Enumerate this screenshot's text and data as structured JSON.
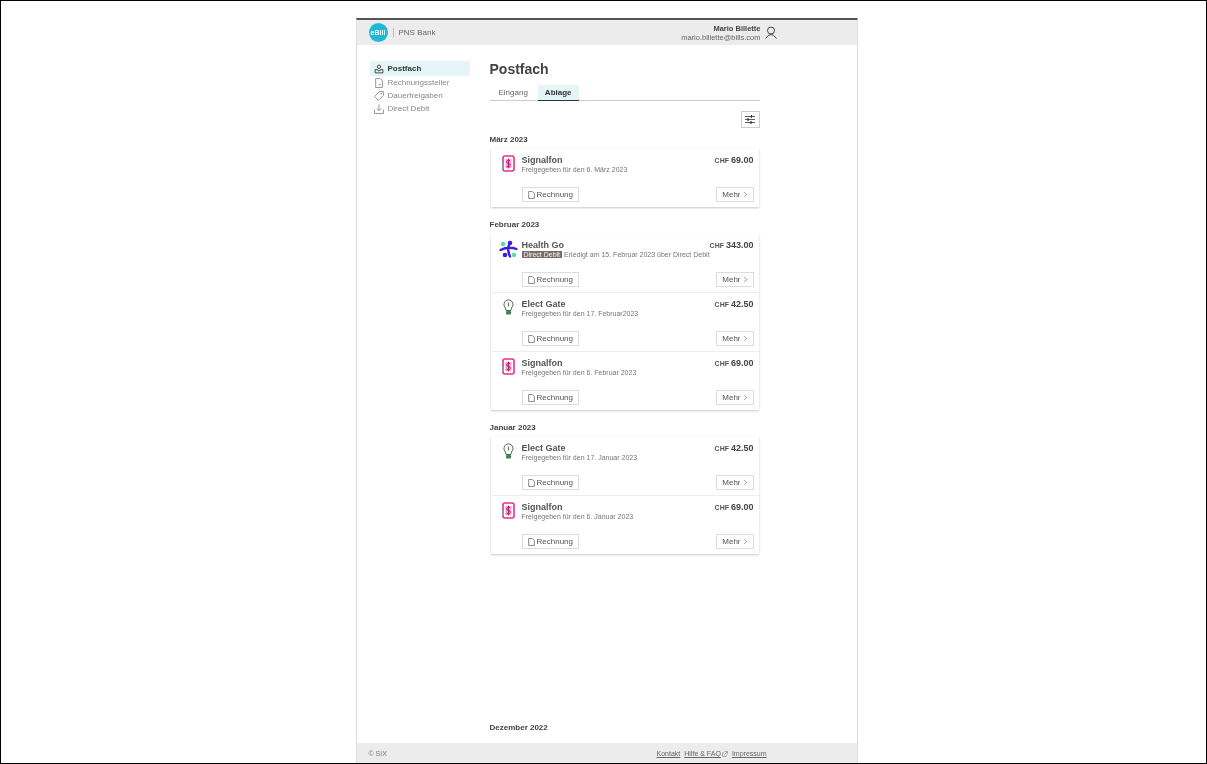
{
  "header": {
    "logo": "eBill",
    "bank": "PNS Bank",
    "user_name": "Mario Billette",
    "user_email": "mario.billette@bills.com"
  },
  "sidebar": {
    "items": [
      {
        "label": "Postfach",
        "selected": true
      },
      {
        "label": "Rechnungssteller",
        "selected": false
      },
      {
        "label": "Dauerfreigaben",
        "selected": false
      },
      {
        "label": "Direct Debit",
        "selected": false
      }
    ]
  },
  "page_title": "Postfach",
  "tabs": [
    {
      "label": "Eingang",
      "selected": false
    },
    {
      "label": "Ablage",
      "selected": true
    }
  ],
  "groups": [
    {
      "title": "März 2023",
      "bills": [
        {
          "biller": "Signalfon",
          "kind": "phone",
          "currency": "CHF",
          "amount": "69.00",
          "status": "Freigegeben für den 6. März 2023",
          "invoice_button": "Rechnung",
          "more_button": "Mehr"
        }
      ]
    },
    {
      "title": "Februar 2023",
      "bills": [
        {
          "biller": "Health Go",
          "kind": "people",
          "currency": "CHF",
          "amount": "343.00",
          "badge": "Direct Debit",
          "status": "Erledigt am 15. Februar 2023 über Direct Debit",
          "invoice_button": "Rechnung",
          "more_button": "Mehr"
        },
        {
          "biller": "Elect Gate",
          "kind": "bulb",
          "currency": "CHF",
          "amount": "42.50",
          "status": "Freigegeben für den 17. Februar2023",
          "invoice_button": "Rechnung",
          "more_button": "Mehr"
        },
        {
          "biller": "Signalfon",
          "kind": "phone",
          "currency": "CHF",
          "amount": "69.00",
          "status": "Freigegeben für den 6. Februar 2023",
          "invoice_button": "Rechnung",
          "more_button": "Mehr"
        }
      ]
    },
    {
      "title": "Januar 2023",
      "bills": [
        {
          "biller": "Elect Gate",
          "kind": "bulb",
          "currency": "CHF",
          "amount": "42.50",
          "status": "Freigegeben für den 17. Januar 2023",
          "invoice_button": "Rechnung",
          "more_button": "Mehr"
        },
        {
          "biller": "Signalfon",
          "kind": "phone",
          "currency": "CHF",
          "amount": "69.00",
          "status": "Freigegeben für den 6. Januar 2023",
          "invoice_button": "Rechnung",
          "more_button": "Mehr"
        }
      ]
    },
    {
      "title": "Dezember 2022"
    }
  ],
  "footer": {
    "copyright": "© SIX",
    "links": [
      {
        "label": "Kontakt",
        "external": false
      },
      {
        "label": "Hilfe & FAQ",
        "external": true
      },
      {
        "label": "Impressum",
        "external": false
      }
    ]
  }
}
